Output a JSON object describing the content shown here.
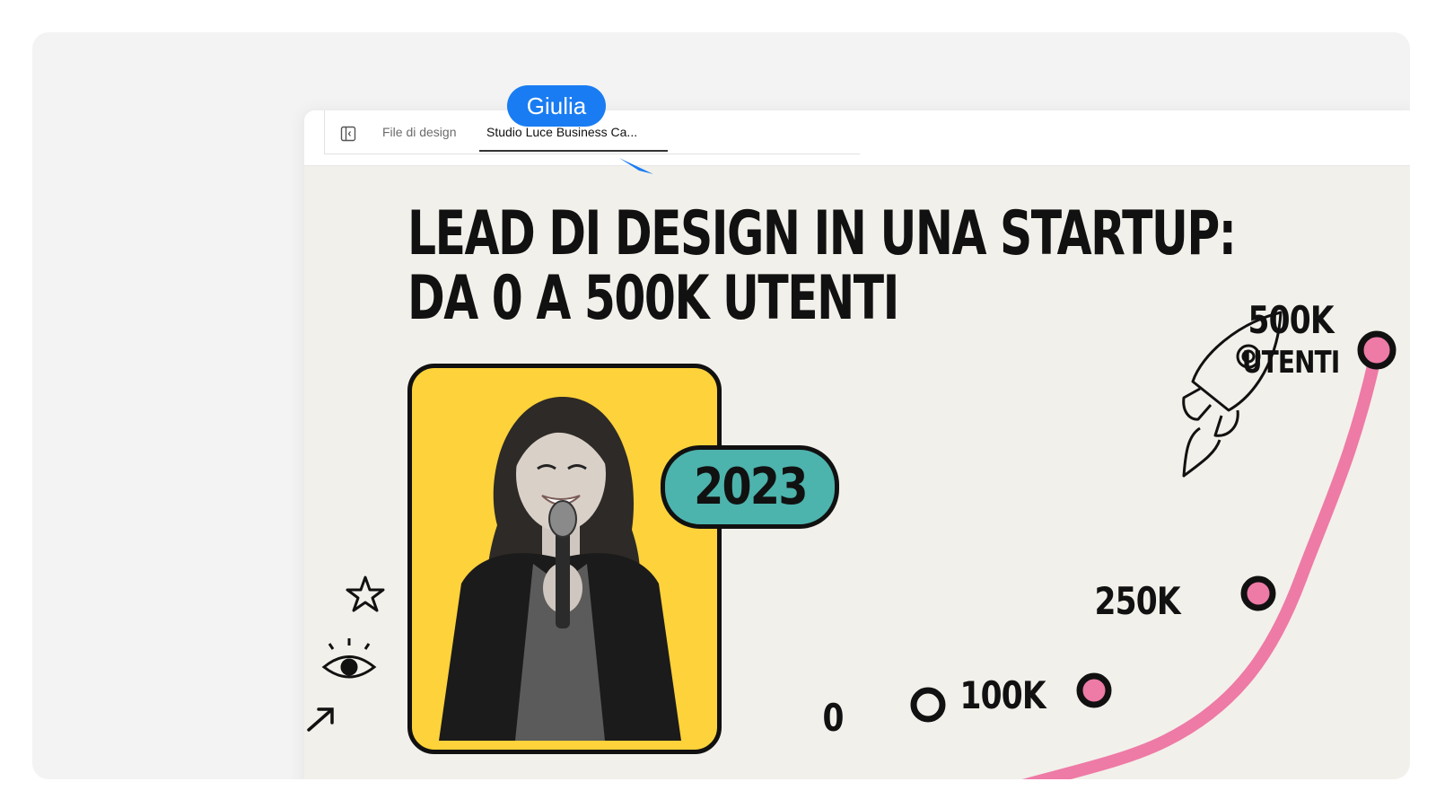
{
  "tabs": {
    "files_label": "File di design",
    "active_label": "Studio Luce Business Ca..."
  },
  "collaborator": {
    "name": "Giulia",
    "color": "#1a7cf2"
  },
  "slide": {
    "title_line1": "LEAD DI DESIGN IN UNA STARTUP:",
    "title_line2": "DA 0 A 500K UTENTI",
    "year": "2023",
    "milestones": {
      "m0": "0",
      "m100": "100K",
      "m250": "250K",
      "m500_line1": "500K",
      "m500_line2": "UTENTI"
    },
    "colors": {
      "background": "#f2f0ea",
      "photo_bg": "#fdd23a",
      "badge": "#4db3ad",
      "curve": "#ee7aa6"
    }
  },
  "icons": [
    "panel-toggle-icon",
    "star-icon",
    "eye-icon",
    "arrow-icon",
    "rocket-icon",
    "sparkle-icon"
  ]
}
